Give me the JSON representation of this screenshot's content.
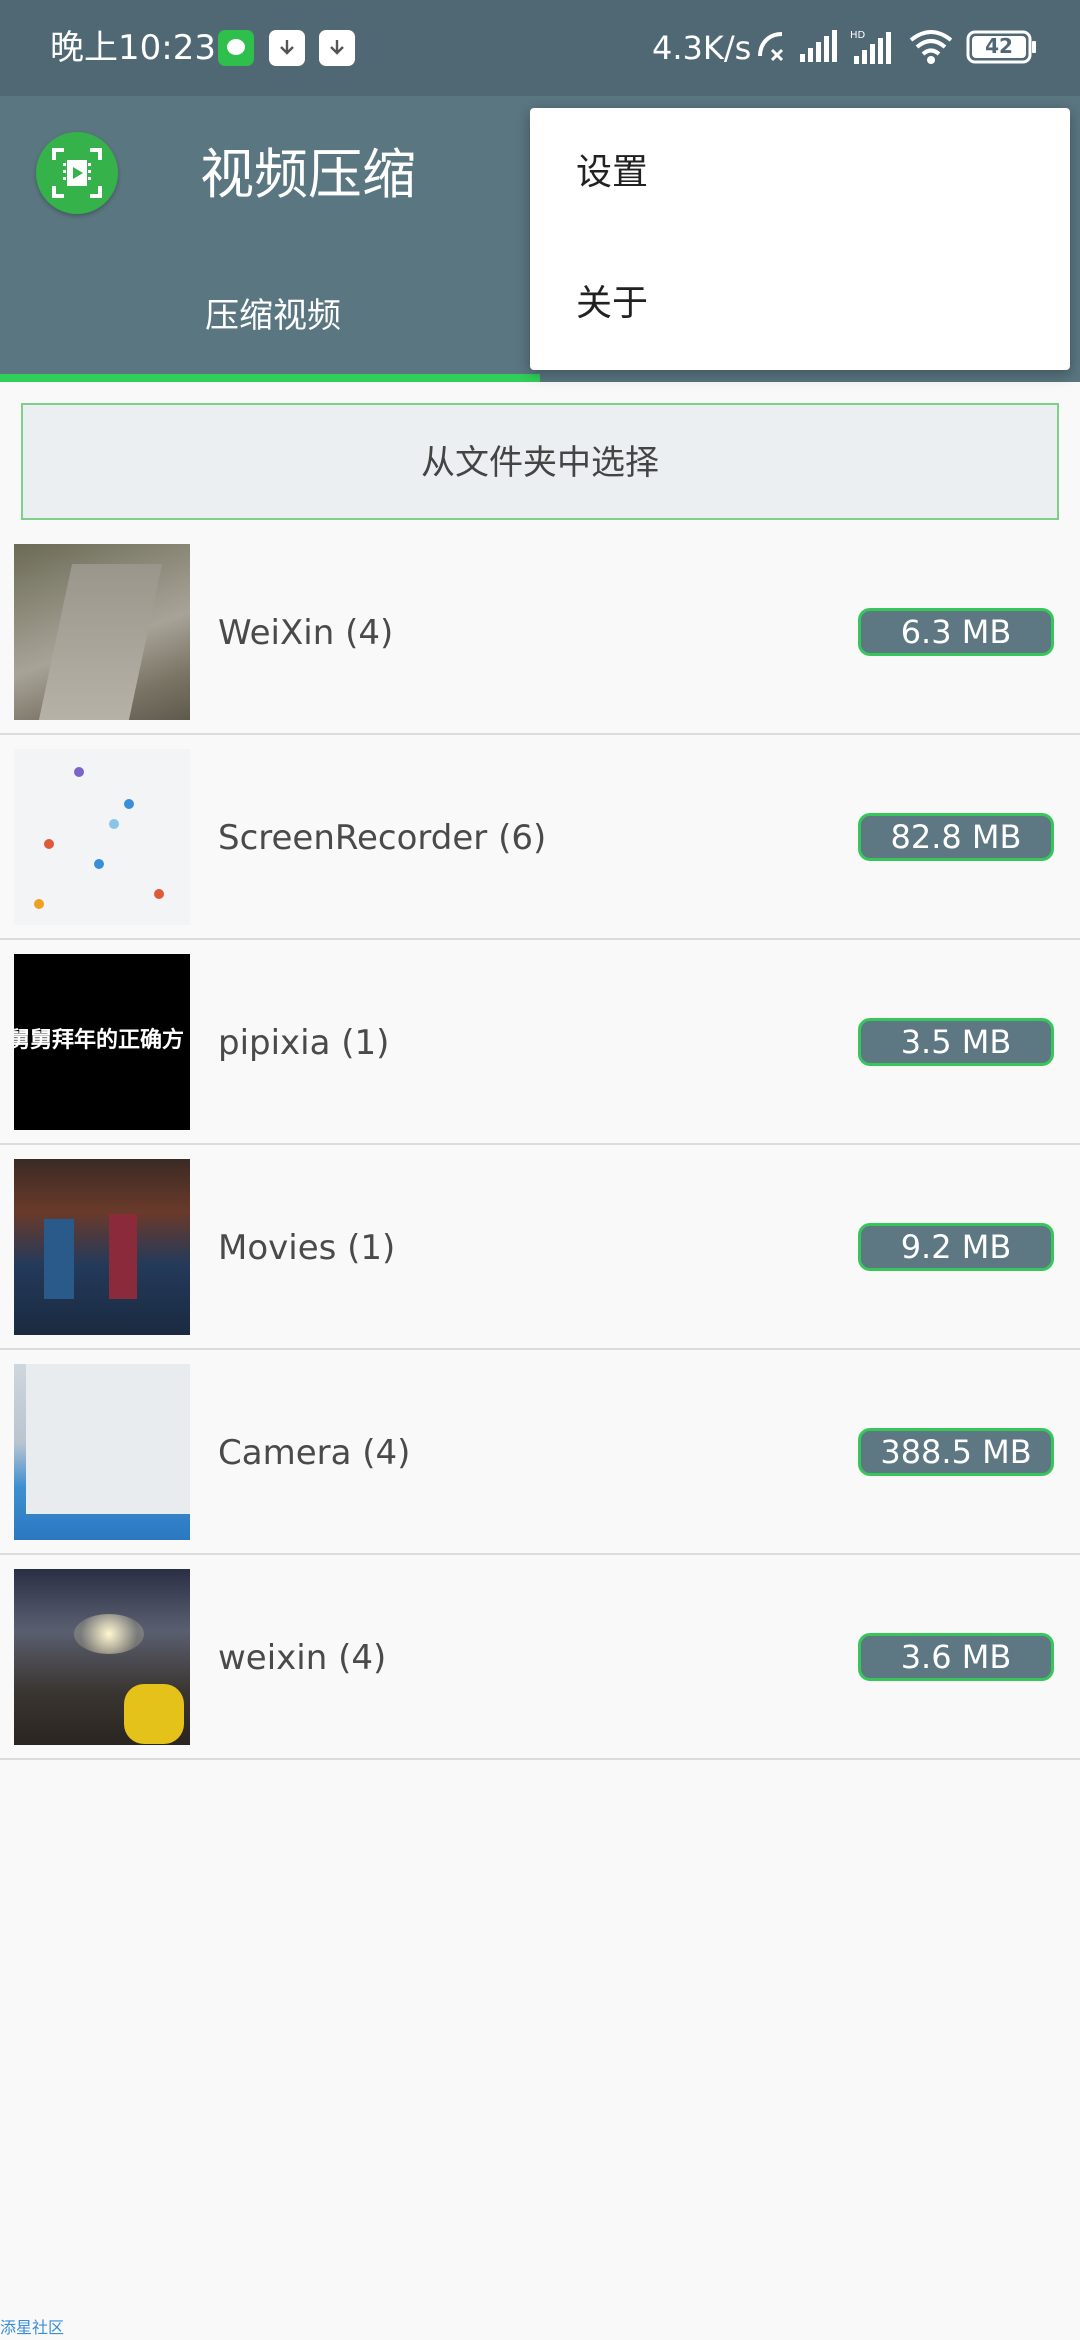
{
  "status_bar": {
    "time": "晚上10:23",
    "network_speed": "4.3K/s",
    "battery": "42",
    "icons": [
      "wechat-notification-icon",
      "download-icon",
      "download-icon",
      "call-off-icon",
      "signal-icon",
      "hd-signal-icon",
      "wifi-icon",
      "battery-icon"
    ]
  },
  "app_bar": {
    "title": "视频压缩",
    "logo_icon": "video-compress-logo-icon",
    "tab_label": "压缩视频",
    "accent_color": "#2fd05a",
    "bar_color": "#5a7680"
  },
  "menu": {
    "items": [
      {
        "label": "设置"
      },
      {
        "label": "关于"
      }
    ]
  },
  "choose_folder": {
    "label": "从文件夹中选择"
  },
  "folders": [
    {
      "name": "WeiXin (4)",
      "size": "6.3 MB"
    },
    {
      "name": "ScreenRecorder (6)",
      "size": "82.8 MB"
    },
    {
      "name": "pipixia (1)",
      "size": "3.5 MB",
      "thumb_text": "舅舅拜年的正确方"
    },
    {
      "name": "Movies (1)",
      "size": "9.2 MB"
    },
    {
      "name": "Camera (4)",
      "size": "388.5 MB"
    },
    {
      "name": "weixin (4)",
      "size": "3.6 MB"
    }
  ],
  "watermark": "添星社区"
}
